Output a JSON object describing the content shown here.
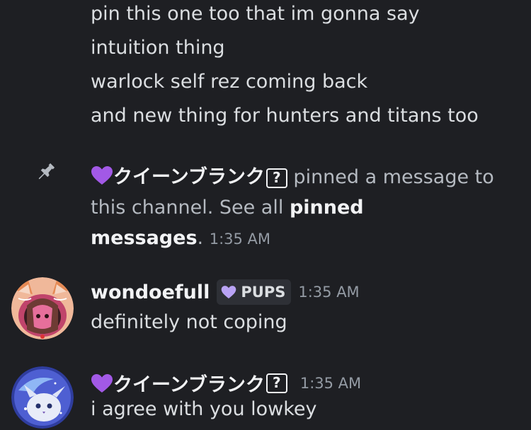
{
  "continued_lines": [
    "pin this one too that im gonna say",
    "intuition thing",
    "warlock self rez coming back",
    "and new thing for hunters and titans too"
  ],
  "system_message": {
    "author": "クイーンブランク",
    "author_badge": "?",
    "text_prefix": " pinned a message to this channel. See all ",
    "link_text": "pinned messages",
    "text_suffix": ".",
    "timestamp": "1:35 AM"
  },
  "messages": [
    {
      "author": "wondoefull",
      "tag": "PUPS",
      "timestamp": "1:35 AM",
      "text": "definitely not coping"
    },
    {
      "author": "クイーンブランク",
      "author_badge": "?",
      "timestamp": "1:35 AM",
      "text": "i agree with you lowkey"
    }
  ],
  "colors": {
    "background": "#1e1f23",
    "heart": "#a259e6",
    "tag_heart": "#b9a3f5"
  },
  "icons": [
    "pin-icon",
    "purple-heart-icon",
    "question-badge-icon"
  ]
}
